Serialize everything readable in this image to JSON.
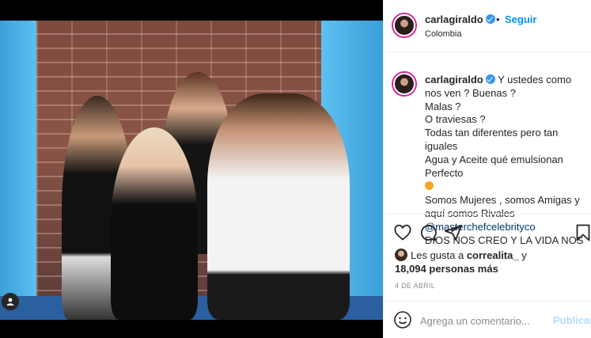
{
  "post": {
    "image_alt": "",
    "user_tag_icon": "user-icon"
  },
  "header": {
    "username": "carlagiraldo",
    "separator": "•",
    "follow_label": "Seguir",
    "location": "Colombia"
  },
  "caption": {
    "username": "carlagiraldo",
    "lines": [
      "Y ustedes como nos ven ? Buenas ?",
      "Malas ?",
      "O traviesas ?",
      "Todas tan diferentes pero tan iguales",
      "Agua y Aceite qué emulsionan Perfecto",
      "Somos Mujeres , somos Amigas y aquí somos Rivales ",
      "DIOS NOS CREO Y LA VIDA NOS"
    ],
    "mention": "@masterchefcelebrityco"
  },
  "actions": {
    "like_icon": "heart-icon",
    "comment_icon": "comment-icon",
    "share_icon": "share-icon",
    "save_icon": "bookmark-icon"
  },
  "likes": {
    "prefix": "Les gusta a ",
    "user": "correalita_",
    "middle": " y",
    "count": "18,094 personas más"
  },
  "date": "4 DE ABRIL",
  "add_comment": {
    "placeholder": "Agrega un comentario...",
    "publish_label": "Publicar"
  },
  "colors": {
    "accent": "#0095f6",
    "verified": "#3897f0",
    "publish_disabled": "#b3dbff"
  }
}
